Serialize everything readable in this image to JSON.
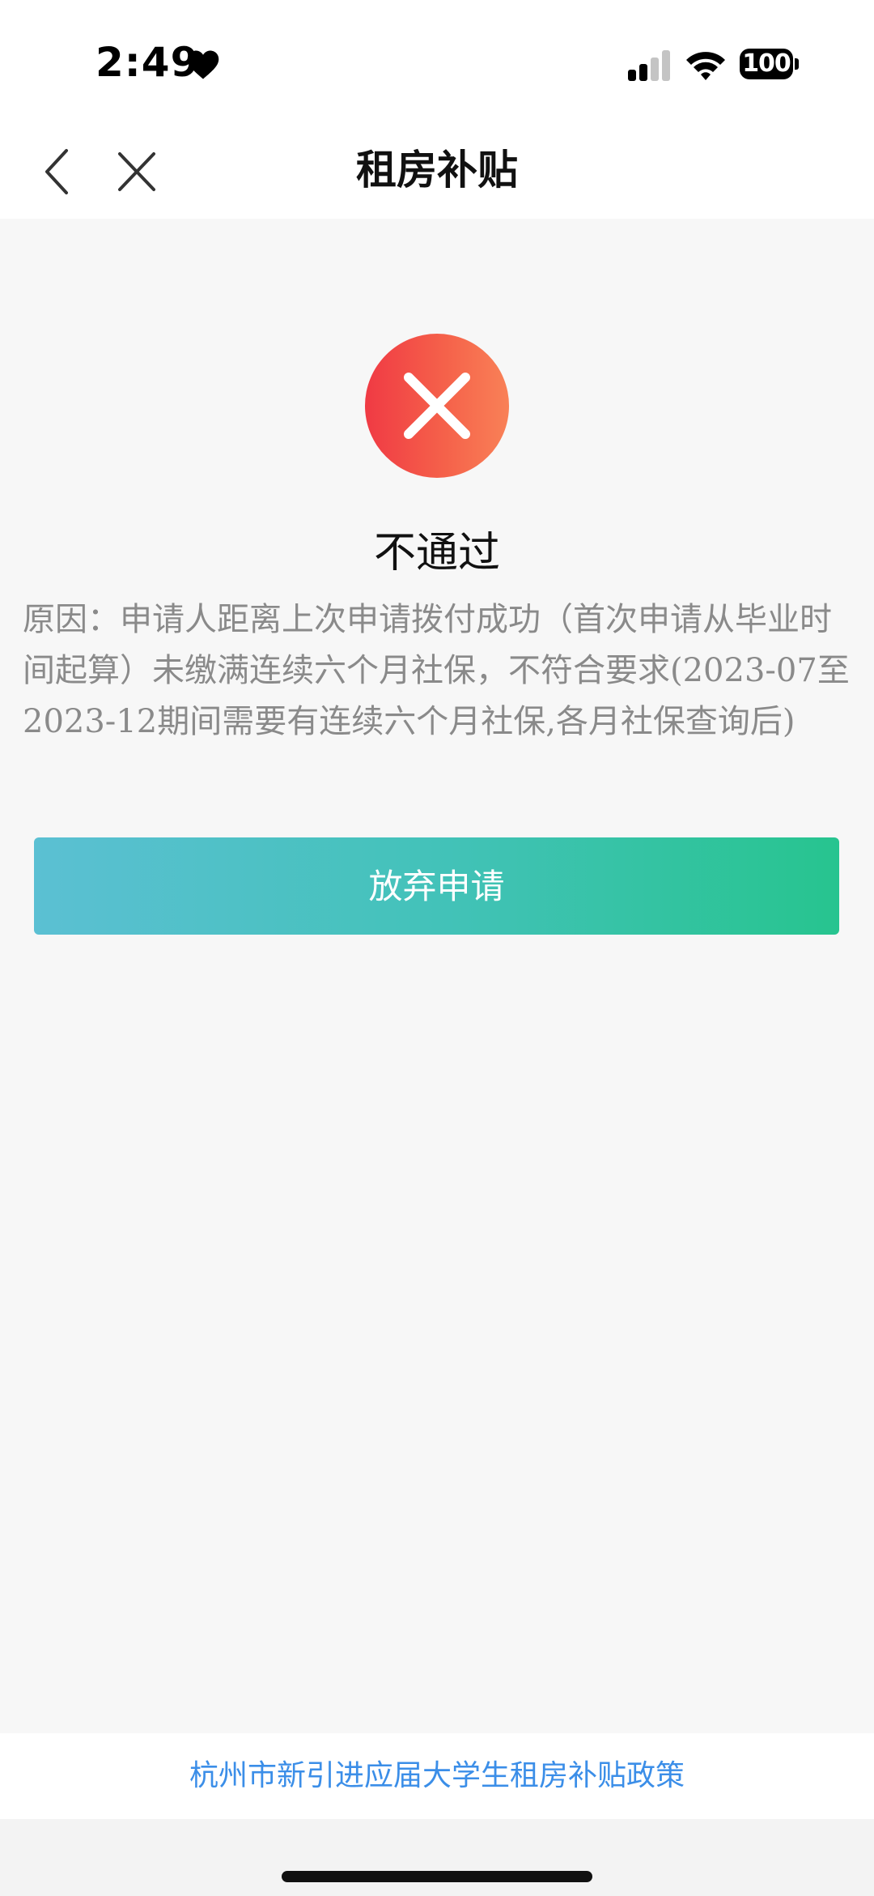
{
  "status_bar": {
    "time": "2:49",
    "battery": "100",
    "icons": [
      "heart-icon",
      "signal-icon",
      "wifi-icon",
      "battery-icon"
    ]
  },
  "nav": {
    "title": "租房补贴",
    "icons": [
      "back-icon",
      "close-icon"
    ]
  },
  "result": {
    "icon": "fail-icon",
    "title": "不通过",
    "reason": "原因：申请人距离上次申请拨付成功（首次申请从毕业时间起算）未缴满连续六个月社保，不符合要求(2023-07至2023-12期间需要有连续六个月社保,各月社保查询后)"
  },
  "actions": {
    "abandon_label": "放弃申请"
  },
  "footer": {
    "policy_link": "杭州市新引进应届大学生租房补贴政策"
  },
  "colors": {
    "fail_red": "#f03a44",
    "button_start": "#5bc0d3",
    "button_end": "#27c48f",
    "link_blue": "#3b8ee8"
  }
}
